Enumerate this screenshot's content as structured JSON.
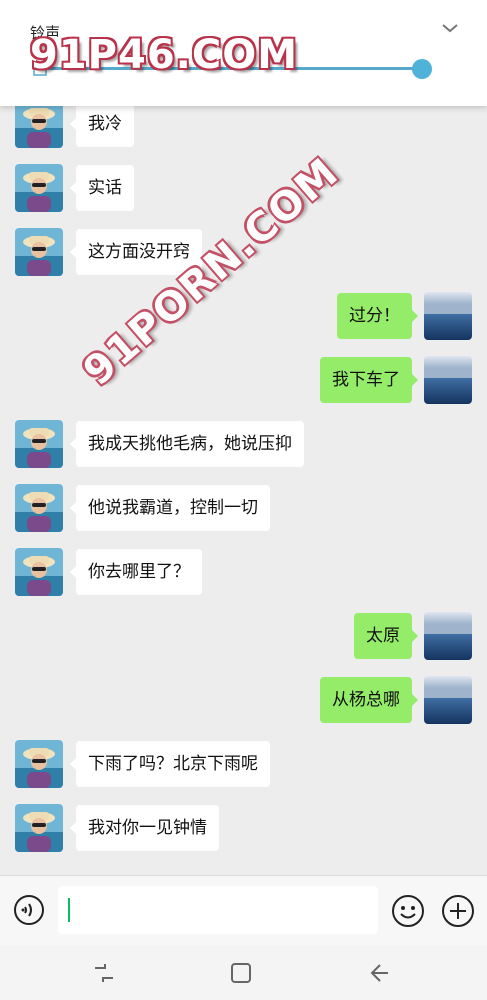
{
  "volume_panel": {
    "title": "铃声",
    "level": 1.0,
    "accent_color": "#4fb2d9",
    "chevron_icon": "chevron-down-icon"
  },
  "watermarks": {
    "top": "91P46.COM",
    "diagonal": "91PORN.COM"
  },
  "messages": [
    {
      "side": "left",
      "text": "我冷",
      "avatar": "contact-avatar"
    },
    {
      "side": "left",
      "text": "实话",
      "avatar": "contact-avatar"
    },
    {
      "side": "left",
      "text": "这方面没开窍",
      "avatar": "contact-avatar"
    },
    {
      "side": "right",
      "text": "过分！",
      "avatar": "self-avatar"
    },
    {
      "side": "right",
      "text": "我下车了",
      "avatar": "self-avatar"
    },
    {
      "side": "left",
      "text": "我成天挑他毛病，她说压抑",
      "avatar": "contact-avatar"
    },
    {
      "side": "left",
      "text": "他说我霸道，控制一切",
      "avatar": "contact-avatar"
    },
    {
      "side": "left",
      "text": "你去哪里了？",
      "avatar": "contact-avatar"
    },
    {
      "side": "right",
      "text": "太原",
      "avatar": "self-avatar"
    },
    {
      "side": "right",
      "text": "从杨总哪",
      "avatar": "self-avatar"
    },
    {
      "side": "left",
      "text": "下雨了吗？北京下雨呢",
      "avatar": "contact-avatar"
    },
    {
      "side": "left",
      "text": "我对你一见钟情",
      "avatar": "contact-avatar"
    }
  ],
  "input_bar": {
    "value": "",
    "voice_icon": "voice-icon",
    "emoji_icon": "emoji-icon",
    "plus_icon": "plus-icon"
  },
  "colors": {
    "sent_bubble": "#95ec69",
    "received_bubble": "#ffffff",
    "chat_background": "#ededed"
  }
}
